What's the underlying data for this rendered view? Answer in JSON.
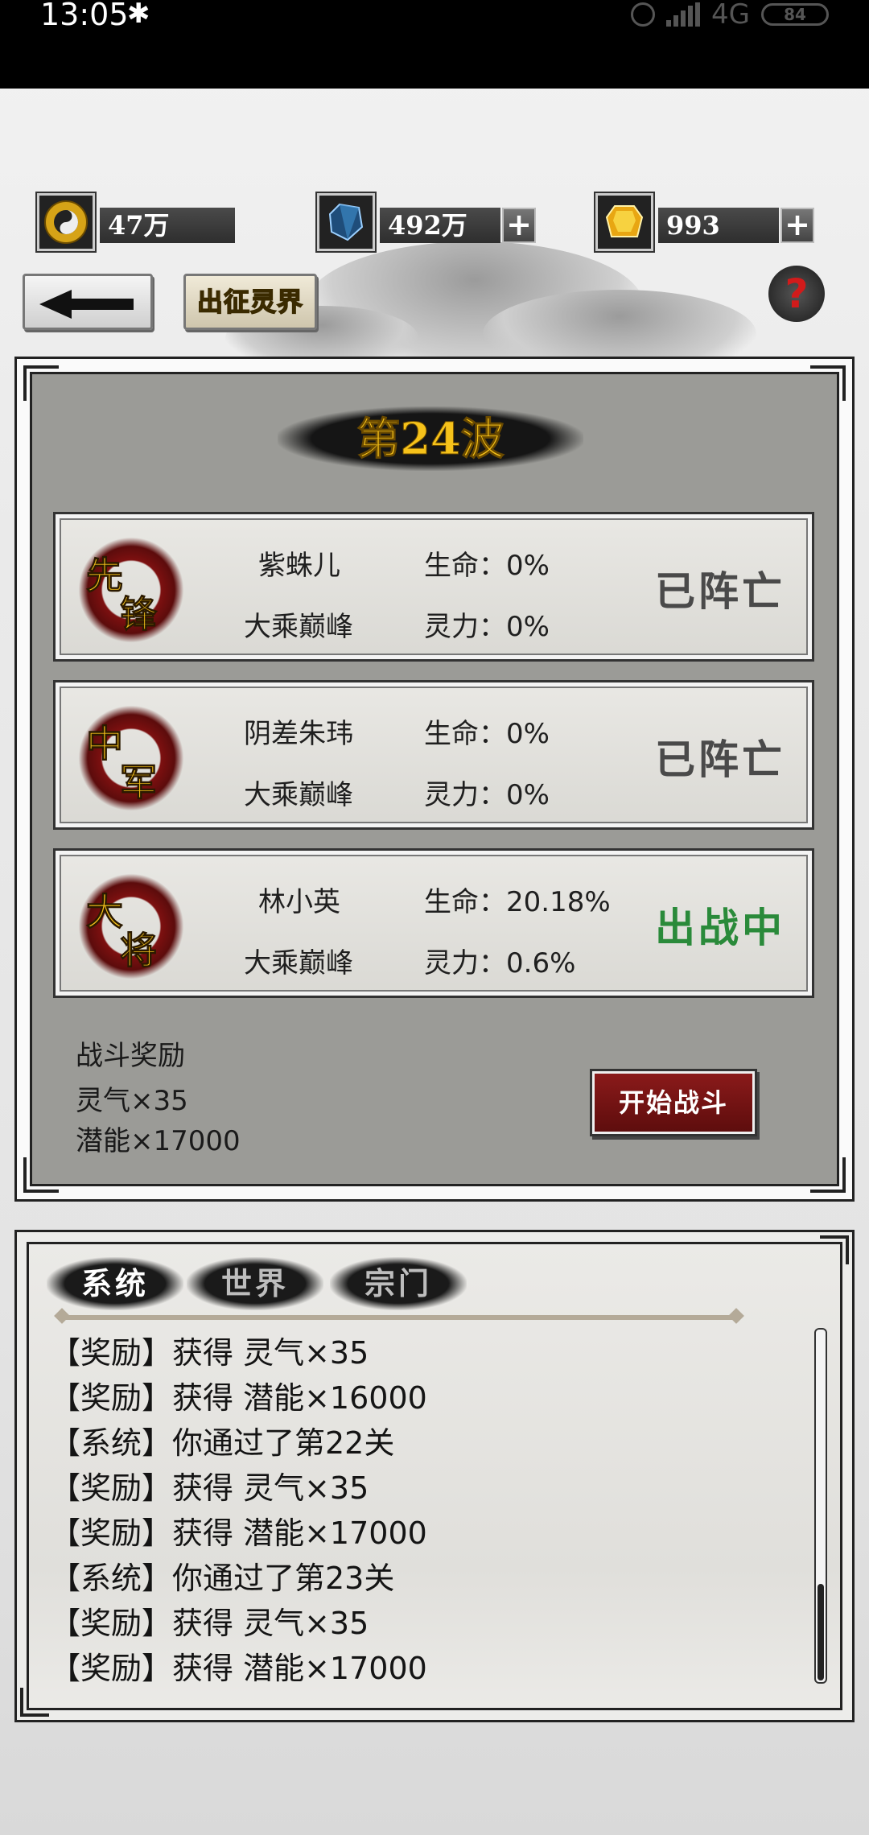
{
  "status_bar": {
    "time": "13:05",
    "network": "4G",
    "battery": "84"
  },
  "resources": [
    {
      "name": "yin-yang-coin",
      "value": "47万"
    },
    {
      "name": "blue-crystal",
      "value": "492万"
    },
    {
      "name": "gold-ingot",
      "value": "993"
    }
  ],
  "header": {
    "title": "出征灵界",
    "help": "?"
  },
  "wave": {
    "title": "第24波"
  },
  "heroes": [
    {
      "role_top": "先",
      "role_bottom": "锋",
      "name": "紫蛛儿",
      "realm": "大乘巅峰",
      "hp": "生命：0%",
      "mp": "灵力：0%",
      "status": "已阵亡",
      "active": false
    },
    {
      "role_top": "中",
      "role_bottom": "军",
      "name": "阴差朱玮",
      "realm": "大乘巅峰",
      "hp": "生命：0%",
      "mp": "灵力：0%",
      "status": "已阵亡",
      "active": false
    },
    {
      "role_top": "大",
      "role_bottom": "将",
      "name": "林小英",
      "realm": "大乘巅峰",
      "hp": "生命：20.18%",
      "mp": "灵力：0.6%",
      "status": "出战中",
      "active": true
    }
  ],
  "rewards": {
    "title": "战斗奖励",
    "items": [
      "灵气×35",
      "潜能×17000"
    ]
  },
  "start_button": "开始战斗",
  "chat": {
    "tabs": [
      "系统",
      "世界",
      "宗门"
    ],
    "active_tab": "系统",
    "lines": [
      "【奖励】获得 灵气×35",
      "【奖励】获得 潜能×16000",
      "【系统】你通过了第22关",
      "【奖励】获得 灵气×35",
      "【奖励】获得 潜能×17000",
      "【系统】你通过了第23关",
      "【奖励】获得 灵气×35",
      "【奖励】获得 潜能×17000"
    ]
  }
}
